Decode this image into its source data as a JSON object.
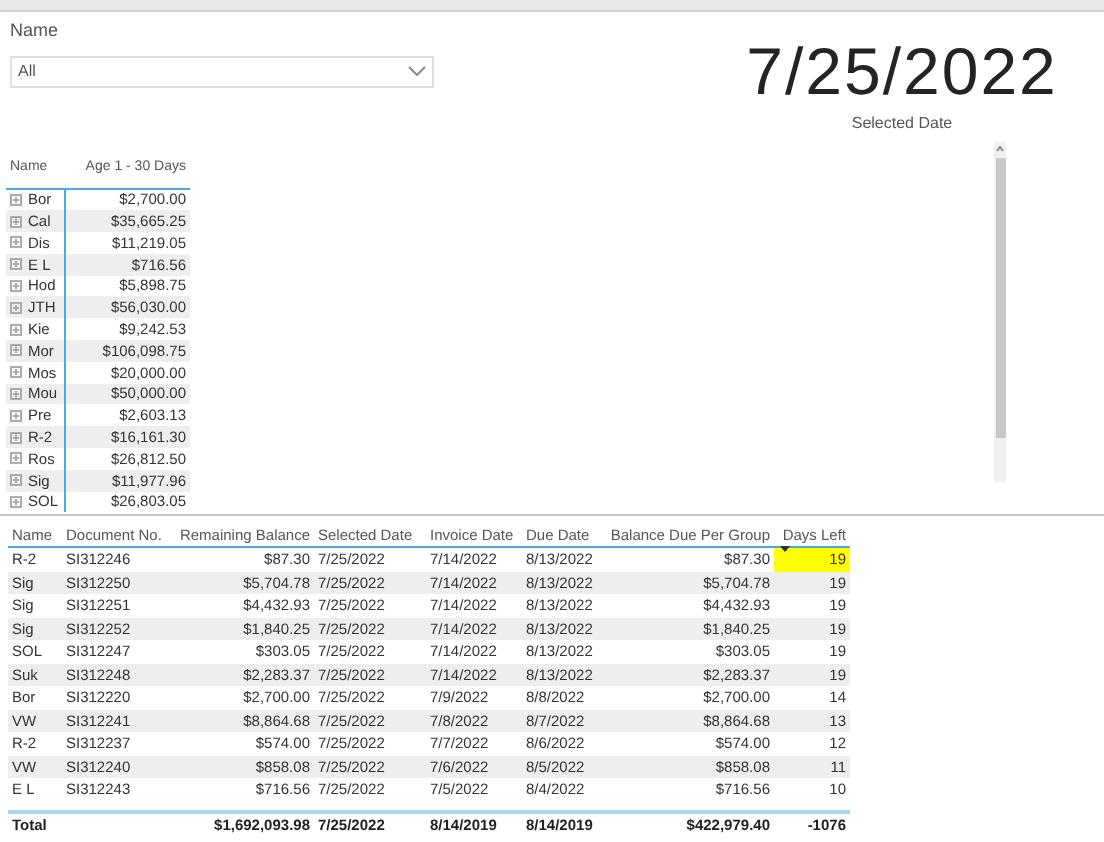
{
  "slicer": {
    "label": "Name",
    "value": "All"
  },
  "card": {
    "value": "7/25/2022",
    "label": "Selected Date"
  },
  "matrix": {
    "columns": [
      "Name",
      "Age 1 - 30 Days"
    ],
    "rows": [
      {
        "name": "Bor",
        "value": "$2,700.00"
      },
      {
        "name": "Cal",
        "value": "$35,665.25"
      },
      {
        "name": "Dis",
        "value": "$11,219.05"
      },
      {
        "name": "E L",
        "value": "$716.56"
      },
      {
        "name": "Hod",
        "value": "$5,898.75"
      },
      {
        "name": "JTH",
        "value": "$56,030.00"
      },
      {
        "name": "Kie",
        "value": "$9,242.53"
      },
      {
        "name": "Mor",
        "value": "$106,098.75"
      },
      {
        "name": "Mos",
        "value": "$20,000.00"
      },
      {
        "name": "Mou",
        "value": "$50,000.00"
      },
      {
        "name": "Pre",
        "value": "$2,603.13"
      },
      {
        "name": "R-2",
        "value": "$16,161.30"
      },
      {
        "name": "Ros",
        "value": "$26,812.50"
      },
      {
        "name": "Sig",
        "value": "$11,977.96"
      },
      {
        "name": "SOL",
        "value": "$26,803.05"
      }
    ]
  },
  "table": {
    "columns": [
      {
        "label": "Name",
        "sorted": false
      },
      {
        "label": "Document No.",
        "sorted": false
      },
      {
        "label": "Remaining Balance",
        "sorted": false
      },
      {
        "label": "Selected Date",
        "sorted": false
      },
      {
        "label": "Invoice Date",
        "sorted": false
      },
      {
        "label": "Due Date",
        "sorted": false
      },
      {
        "label": "Balance Due Per Group",
        "sorted": false
      },
      {
        "label": "Days Left",
        "sorted": true
      }
    ],
    "rows": [
      {
        "cells": [
          "R-2",
          "SI312246",
          "$87.30",
          "7/25/2022",
          "7/14/2022",
          "8/13/2022",
          "$87.30",
          "19"
        ],
        "highlighted": true
      },
      {
        "cells": [
          "Sig",
          "SI312250",
          "$5,704.78",
          "7/25/2022",
          "7/14/2022",
          "8/13/2022",
          "$5,704.78",
          "19"
        ],
        "highlighted": false
      },
      {
        "cells": [
          "Sig",
          "SI312251",
          "$4,432.93",
          "7/25/2022",
          "7/14/2022",
          "8/13/2022",
          "$4,432.93",
          "19"
        ],
        "highlighted": false
      },
      {
        "cells": [
          "Sig",
          "SI312252",
          "$1,840.25",
          "7/25/2022",
          "7/14/2022",
          "8/13/2022",
          "$1,840.25",
          "19"
        ],
        "highlighted": false
      },
      {
        "cells": [
          "SOL",
          "SI312247",
          "$303.05",
          "7/25/2022",
          "7/14/2022",
          "8/13/2022",
          "$303.05",
          "19"
        ],
        "highlighted": false
      },
      {
        "cells": [
          "Suk",
          "SI312248",
          "$2,283.37",
          "7/25/2022",
          "7/14/2022",
          "8/13/2022",
          "$2,283.37",
          "19"
        ],
        "highlighted": false
      },
      {
        "cells": [
          "Bor",
          "SI312220",
          "$2,700.00",
          "7/25/2022",
          "7/9/2022",
          "8/8/2022",
          "$2,700.00",
          "14"
        ],
        "highlighted": false
      },
      {
        "cells": [
          "VW",
          "SI312241",
          "$8,864.68",
          "7/25/2022",
          "7/8/2022",
          "8/7/2022",
          "$8,864.68",
          "13"
        ],
        "highlighted": false
      },
      {
        "cells": [
          "R-2",
          "SI312237",
          "$574.00",
          "7/25/2022",
          "7/7/2022",
          "8/6/2022",
          "$574.00",
          "12"
        ],
        "highlighted": false
      },
      {
        "cells": [
          "VW",
          "SI312240",
          "$858.08",
          "7/25/2022",
          "7/6/2022",
          "8/5/2022",
          "$858.08",
          "11"
        ],
        "highlighted": false
      },
      {
        "cells": [
          "E L",
          "SI312243",
          "$716.56",
          "7/25/2022",
          "7/5/2022",
          "8/4/2022",
          "$716.56",
          "10"
        ],
        "highlighted": false
      }
    ],
    "total": {
      "label": "Total",
      "values": [
        "$1,692,093.98",
        "7/25/2022",
        "8/14/2019",
        "8/14/2019",
        "$422,979.40",
        "-1076"
      ]
    }
  }
}
